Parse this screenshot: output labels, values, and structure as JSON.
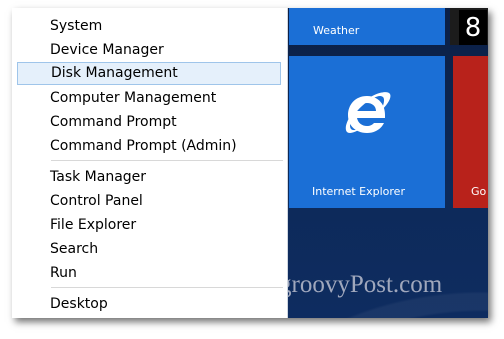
{
  "menu": {
    "items": [
      {
        "label": "System"
      },
      {
        "label": "Device Manager"
      },
      {
        "label": "Disk Management",
        "selected": true
      },
      {
        "label": "Computer Management"
      },
      {
        "label": "Command Prompt"
      },
      {
        "label": "Command Prompt (Admin)"
      },
      {
        "label": "Task Manager"
      },
      {
        "label": "Control Panel"
      },
      {
        "label": "File Explorer"
      },
      {
        "label": "Search"
      },
      {
        "label": "Run"
      },
      {
        "label": "Desktop"
      }
    ]
  },
  "tiles": {
    "weather": "Weather",
    "ie": "Internet Explorer",
    "partial": "Go",
    "number": "8"
  },
  "watermark": "groovyPost.com",
  "colors": {
    "tile_blue": "#1b6fd6",
    "tile_red": "#b8221b",
    "menu_selected": "#e5f0fb",
    "start_bg": "#0c2348"
  }
}
